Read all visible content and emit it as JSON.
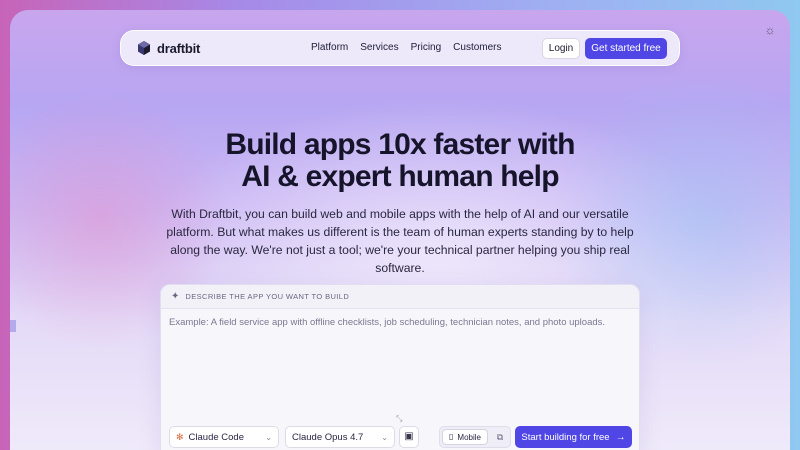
{
  "nav": {
    "logo": "draftbit",
    "links": [
      "Platform",
      "Services",
      "Pricing",
      "Customers"
    ],
    "login_label": "Login",
    "cta_label": "Get started free"
  },
  "hero": {
    "title_line1": "Build apps 10x faster with",
    "title_line2": "AI & expert human help",
    "description": "With Draftbit, you can build web and mobile apps with the help of AI and our versatile platform. But what makes us different is the team of human experts standing by to help along the way. We're not just a tool; we're your technical partner helping you ship real software."
  },
  "prompt": {
    "label": "DESCRIBE THE APP YOU WANT TO BUILD",
    "placeholder": "Example: A field service app with offline checklists, job scheduling, technician notes, and photo uploads.",
    "agent_value": "Claude Code",
    "model_value": "Claude Opus 4.7",
    "device_mobile_label": "Mobile",
    "start_label": "Start building for free"
  },
  "colors": {
    "accent": "#4f46e5",
    "text_dark": "#16142a"
  },
  "icons": {
    "logo": "cube-icon",
    "theme": "sun-icon",
    "sparkle": "sparkle-icon",
    "agent": "claude-icon",
    "model": "claude-icon",
    "image": "image-icon",
    "phone": "phone-icon",
    "web": "devices-icon",
    "arrow": "arrow-right-icon"
  }
}
